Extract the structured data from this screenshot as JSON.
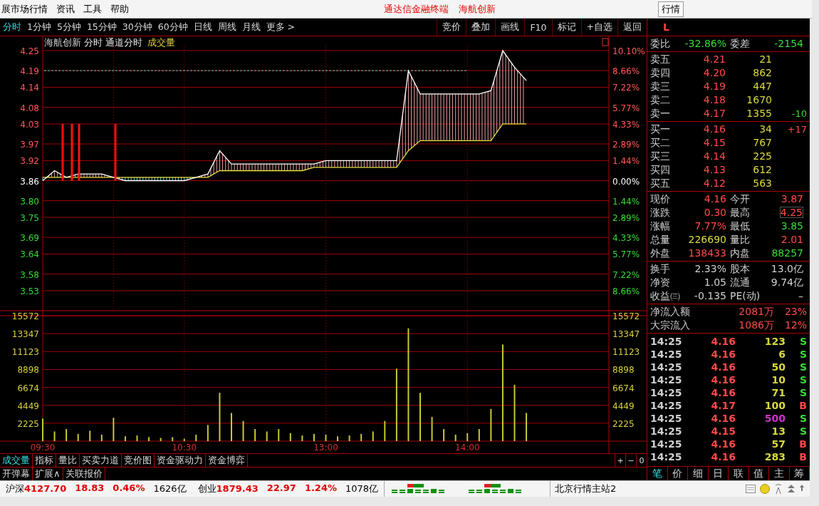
{
  "menu_bar": {
    "items": [
      "展市场行情",
      "资讯",
      "工具",
      "帮助"
    ],
    "center": [
      "通达信金融终端",
      "海航创新"
    ],
    "right_button": "行情"
  },
  "period_tabs": [
    {
      "label": "分时",
      "selected": true
    },
    {
      "label": "1分钟",
      "selected": false
    },
    {
      "label": "5分钟",
      "selected": false
    },
    {
      "label": "15分钟",
      "selected": false
    },
    {
      "label": "30分钟",
      "selected": false
    },
    {
      "label": "60分钟",
      "selected": false
    },
    {
      "label": "日线",
      "selected": false
    },
    {
      "label": "周线",
      "selected": false
    },
    {
      "label": "月线",
      "selected": false
    },
    {
      "label": "更多 >",
      "selected": false
    }
  ],
  "tool_buttons": [
    "竞价",
    "叠加",
    "画线",
    "F10",
    "标记",
    "+自选",
    "返回"
  ],
  "panel_header": {
    "mark": "L"
  },
  "chart_header": {
    "symbol": "海航创新",
    "labels": [
      "分时",
      "通道分时"
    ],
    "indicator": "成交量"
  },
  "price_chart": {
    "right_axis": [
      {
        "label": "10.10%",
        "color": "#ff5a5a"
      },
      {
        "label": "8.66%",
        "color": "#ff5a5a"
      },
      {
        "label": "7.22%",
        "color": "#ff5a5a"
      },
      {
        "label": "5.77%",
        "color": "#ff5a5a"
      },
      {
        "label": "4.33%",
        "color": "#ff5a5a"
      },
      {
        "label": "2.89%",
        "color": "#ff5a5a"
      },
      {
        "label": "1.44%",
        "color": "#ff5a5a"
      },
      {
        "label": "0.00%",
        "color": "#ffffff"
      },
      {
        "label": "1.44%",
        "color": "#3ad83a"
      },
      {
        "label": "2.89%",
        "color": "#3ad83a"
      },
      {
        "label": "4.33%",
        "color": "#3ad83a"
      },
      {
        "label": "5.77%",
        "color": "#3ad83a"
      },
      {
        "label": "7.22%",
        "color": "#3ad83a"
      },
      {
        "label": "8.66%",
        "color": "#3ad83a"
      }
    ],
    "chart_data": {
      "type": "line",
      "grid": true,
      "ylim": [
        3.47,
        4.25
      ],
      "yticks": [
        {
          "value": 4.25,
          "label": "4.25"
        },
        {
          "value": 4.19,
          "label": "4.19"
        },
        {
          "value": 4.14,
          "label": "4.14"
        },
        {
          "value": 4.08,
          "label": "4.08"
        },
        {
          "value": 4.03,
          "label": "4.03"
        },
        {
          "value": 3.97,
          "label": "3.97"
        },
        {
          "value": 3.92,
          "label": "3.92"
        },
        {
          "value": 3.86,
          "label": "3.86"
        },
        {
          "value": 3.8,
          "label": "3.80"
        },
        {
          "value": 3.75,
          "label": "3.75"
        },
        {
          "value": 3.69,
          "label": "3.69"
        },
        {
          "value": 3.64,
          "label": "3.64"
        },
        {
          "value": 3.58,
          "label": "3.58"
        },
        {
          "value": 3.53,
          "label": "3.53"
        }
      ],
      "series": [
        {
          "color": "#ffffff",
          "values": [
            3.86,
            3.89,
            3.87,
            3.88,
            3.88,
            3.88,
            3.87,
            3.86,
            3.86,
            3.86,
            3.86,
            3.86,
            3.86,
            3.87,
            3.88,
            3.95,
            3.91,
            3.91,
            3.91,
            3.91,
            3.91,
            3.91,
            3.91,
            3.91,
            3.92,
            3.92,
            3.92,
            3.92,
            3.92,
            3.92,
            3.92,
            4.19,
            4.12,
            4.12,
            4.12,
            4.12,
            4.12,
            4.12,
            4.13,
            4.25,
            4.2,
            4.16,
            null,
            null,
            null,
            null,
            null,
            null,
            null
          ]
        },
        {
          "color": "#e8e040",
          "values": [
            3.87,
            3.87,
            3.87,
            3.87,
            3.87,
            3.87,
            3.87,
            3.87,
            3.87,
            3.87,
            3.87,
            3.87,
            3.87,
            3.87,
            3.87,
            3.89,
            3.89,
            3.89,
            3.89,
            3.89,
            3.89,
            3.89,
            3.89,
            3.9,
            3.9,
            3.9,
            3.9,
            3.9,
            3.9,
            3.9,
            3.9,
            3.95,
            3.98,
            3.98,
            3.98,
            3.98,
            3.98,
            3.98,
            3.98,
            4.03,
            4.03,
            4.03,
            null,
            null,
            null,
            null,
            null,
            null,
            null
          ]
        }
      ]
    }
  },
  "volume_chart": {
    "right_axis": [
      "15572",
      "13347",
      "11123",
      "8898",
      "6674",
      "4449",
      "2225"
    ],
    "chart_data": {
      "type": "bar",
      "grid": true,
      "ylim": [
        0,
        15572
      ],
      "categories": [
        "09:30",
        null,
        null,
        null,
        null,
        null,
        null,
        null,
        null,
        null,
        null,
        null,
        "10:30",
        null,
        null,
        null,
        null,
        null,
        null,
        null,
        null,
        null,
        null,
        null,
        "13:00",
        null,
        null,
        null,
        null,
        null,
        null,
        null,
        null,
        null,
        null,
        null,
        "14:00",
        null,
        null,
        null,
        null,
        null,
        null,
        null,
        null,
        null,
        null,
        null,
        null
      ],
      "yticks": [
        {
          "value": 15572,
          "label": "15572"
        },
        {
          "value": 13347,
          "label": "13347"
        },
        {
          "value": 11123,
          "label": "11123"
        },
        {
          "value": 8898,
          "label": "8898"
        },
        {
          "value": 6674,
          "label": "6674"
        },
        {
          "value": 4449,
          "label": "4449"
        },
        {
          "value": 2225,
          "label": "2225"
        }
      ],
      "series": [
        {
          "color": "#c8c832",
          "values": [
            2800,
            1200,
            1500,
            900,
            1300,
            800,
            2900,
            600,
            700,
            500,
            400,
            500,
            300,
            800,
            2000,
            6000,
            3500,
            2500,
            1500,
            1200,
            1500,
            1000,
            700,
            900,
            800,
            600,
            700,
            900,
            1200,
            2500,
            9000,
            14000,
            6000,
            3000,
            1500,
            800,
            1000,
            1500,
            4000,
            12000,
            7000,
            3500,
            null,
            null,
            null,
            null,
            null,
            null,
            null
          ]
        }
      ]
    }
  },
  "zoom_buttons": [
    "+",
    "−",
    "0"
  ],
  "indicator_tabs": [
    {
      "label": "成交量",
      "selected": true
    },
    {
      "label": "指标",
      "selected": false
    },
    {
      "label": "量比",
      "selected": false
    },
    {
      "label": "买卖力道",
      "selected": false
    },
    {
      "label": "竞价图",
      "selected": false
    },
    {
      "label": "资金驱动力",
      "selected": false
    },
    {
      "label": "资金博弈",
      "selected": false
    }
  ],
  "extra_tabs": [
    "开弹幕",
    "扩展∧",
    "关联报价"
  ],
  "quote": {
    "ratio": [
      {
        "label": "委比",
        "value": "-32.86%",
        "color": "#3ad83a"
      },
      {
        "label": "委差",
        "value": "-2154",
        "color": "#3ad83a"
      }
    ],
    "asks": [
      {
        "label": "卖五",
        "price": "4.21",
        "volume": "21"
      },
      {
        "label": "卖四",
        "price": "4.20",
        "volume": "862"
      },
      {
        "label": "卖三",
        "price": "4.19",
        "volume": "447"
      },
      {
        "label": "卖二",
        "price": "4.18",
        "volume": "1670"
      },
      {
        "label": "卖一",
        "price": "4.17",
        "volume": "1355",
        "change": "-10",
        "color": "#3ad83a"
      }
    ],
    "bids": [
      {
        "label": "买一",
        "price": "4.16",
        "volume": "34",
        "change": "+17",
        "color": "#ff4a4a"
      },
      {
        "label": "买二",
        "price": "4.15",
        "volume": "767"
      },
      {
        "label": "买三",
        "price": "4.14",
        "volume": "225"
      },
      {
        "label": "买四",
        "price": "4.13",
        "volume": "612"
      },
      {
        "label": "买五",
        "price": "4.12",
        "volume": "563"
      }
    ],
    "stats": [
      {
        "label": "现价",
        "value": "4.16",
        "color": "#ff4a4a",
        "boxed": false
      },
      {
        "label": "今开",
        "value": "3.87",
        "color": "#ff4a4a",
        "boxed": false
      },
      {
        "label": "涨跌",
        "value": "0.30",
        "color": "#ff4a4a",
        "boxed": false
      },
      {
        "label": "最高",
        "value": "4.25",
        "color": "#ff4a4a",
        "boxed": true
      },
      {
        "label": "涨幅",
        "value": "7.77%",
        "color": "#ff4a4a",
        "boxed": false
      },
      {
        "label": "最低",
        "value": "3.85",
        "color": "#3ad83a",
        "boxed": false
      },
      {
        "label": "总量",
        "value": "226690",
        "color": "#d8d840",
        "boxed": false
      },
      {
        "label": "量比",
        "value": "2.01",
        "color": "#ff4a4a",
        "boxed": false
      },
      {
        "label": "外盘",
        "value": "138433",
        "color": "#ff4a4a",
        "boxed": false
      },
      {
        "label": "内盘",
        "value": "88257",
        "color": "#3ad83a",
        "boxed": false
      }
    ],
    "fundamentals": [
      {
        "label": "换手",
        "value": "2.33%"
      },
      {
        "label": "股本",
        "value": "13.0亿"
      },
      {
        "label": "净资",
        "value": "1.05"
      },
      {
        "label": "流通",
        "value": "9.74亿"
      },
      {
        "label": "收益㈢",
        "value": "-0.135"
      },
      {
        "label": "PE(动)",
        "value": "–"
      }
    ],
    "flows": [
      {
        "label": "净流入额",
        "amount": "2081万",
        "share": "23%"
      },
      {
        "label": "大宗流入",
        "amount": "1086万",
        "share": "12%"
      }
    ],
    "ticks": [
      {
        "time": "14:25",
        "price": "4.16",
        "volume": "123",
        "side": "S",
        "kind": "sell",
        "large": false
      },
      {
        "time": "14:25",
        "price": "4.16",
        "volume": "6",
        "side": "S",
        "kind": "sell",
        "large": false
      },
      {
        "time": "14:25",
        "price": "4.16",
        "volume": "50",
        "side": "S",
        "kind": "sell",
        "large": false
      },
      {
        "time": "14:25",
        "price": "4.16",
        "volume": "10",
        "side": "S",
        "kind": "sell",
        "large": false
      },
      {
        "time": "14:25",
        "price": "4.16",
        "volume": "71",
        "side": "S",
        "kind": "sell",
        "large": false
      },
      {
        "time": "14:25",
        "price": "4.17",
        "volume": "100",
        "side": "B",
        "kind": "buy",
        "large": false
      },
      {
        "time": "14:25",
        "price": "4.16",
        "volume": "500",
        "side": "S",
        "kind": "sell",
        "large": true
      },
      {
        "time": "14:25",
        "price": "4.15",
        "volume": "13",
        "side": "S",
        "kind": "sell",
        "large": false
      },
      {
        "time": "14:25",
        "price": "4.16",
        "volume": "57",
        "side": "B",
        "kind": "buy",
        "large": false
      },
      {
        "time": "14:25",
        "price": "4.16",
        "volume": "283",
        "side": "B",
        "kind": "buy",
        "large": false
      }
    ],
    "tabs": [
      {
        "label": "笔",
        "selected": true
      },
      {
        "label": "价",
        "selected": false
      },
      {
        "label": "细",
        "selected": false
      },
      {
        "label": "日",
        "selected": false
      },
      {
        "label": "联",
        "selected": false
      },
      {
        "label": "值",
        "selected": false
      },
      {
        "label": "主",
        "selected": false
      },
      {
        "label": "筹",
        "selected": false
      }
    ]
  },
  "status_bar": {
    "indices": [
      {
        "name": "沪深",
        "value": "4127.70",
        "change": "18.83",
        "percent": "0.46%",
        "turnover": "1626亿"
      },
      {
        "name": "创业",
        "value": "1879.43",
        "change": "22.97",
        "percent": "1.24%",
        "turnover": "1078亿"
      }
    ],
    "server": "北京行情主站2"
  }
}
